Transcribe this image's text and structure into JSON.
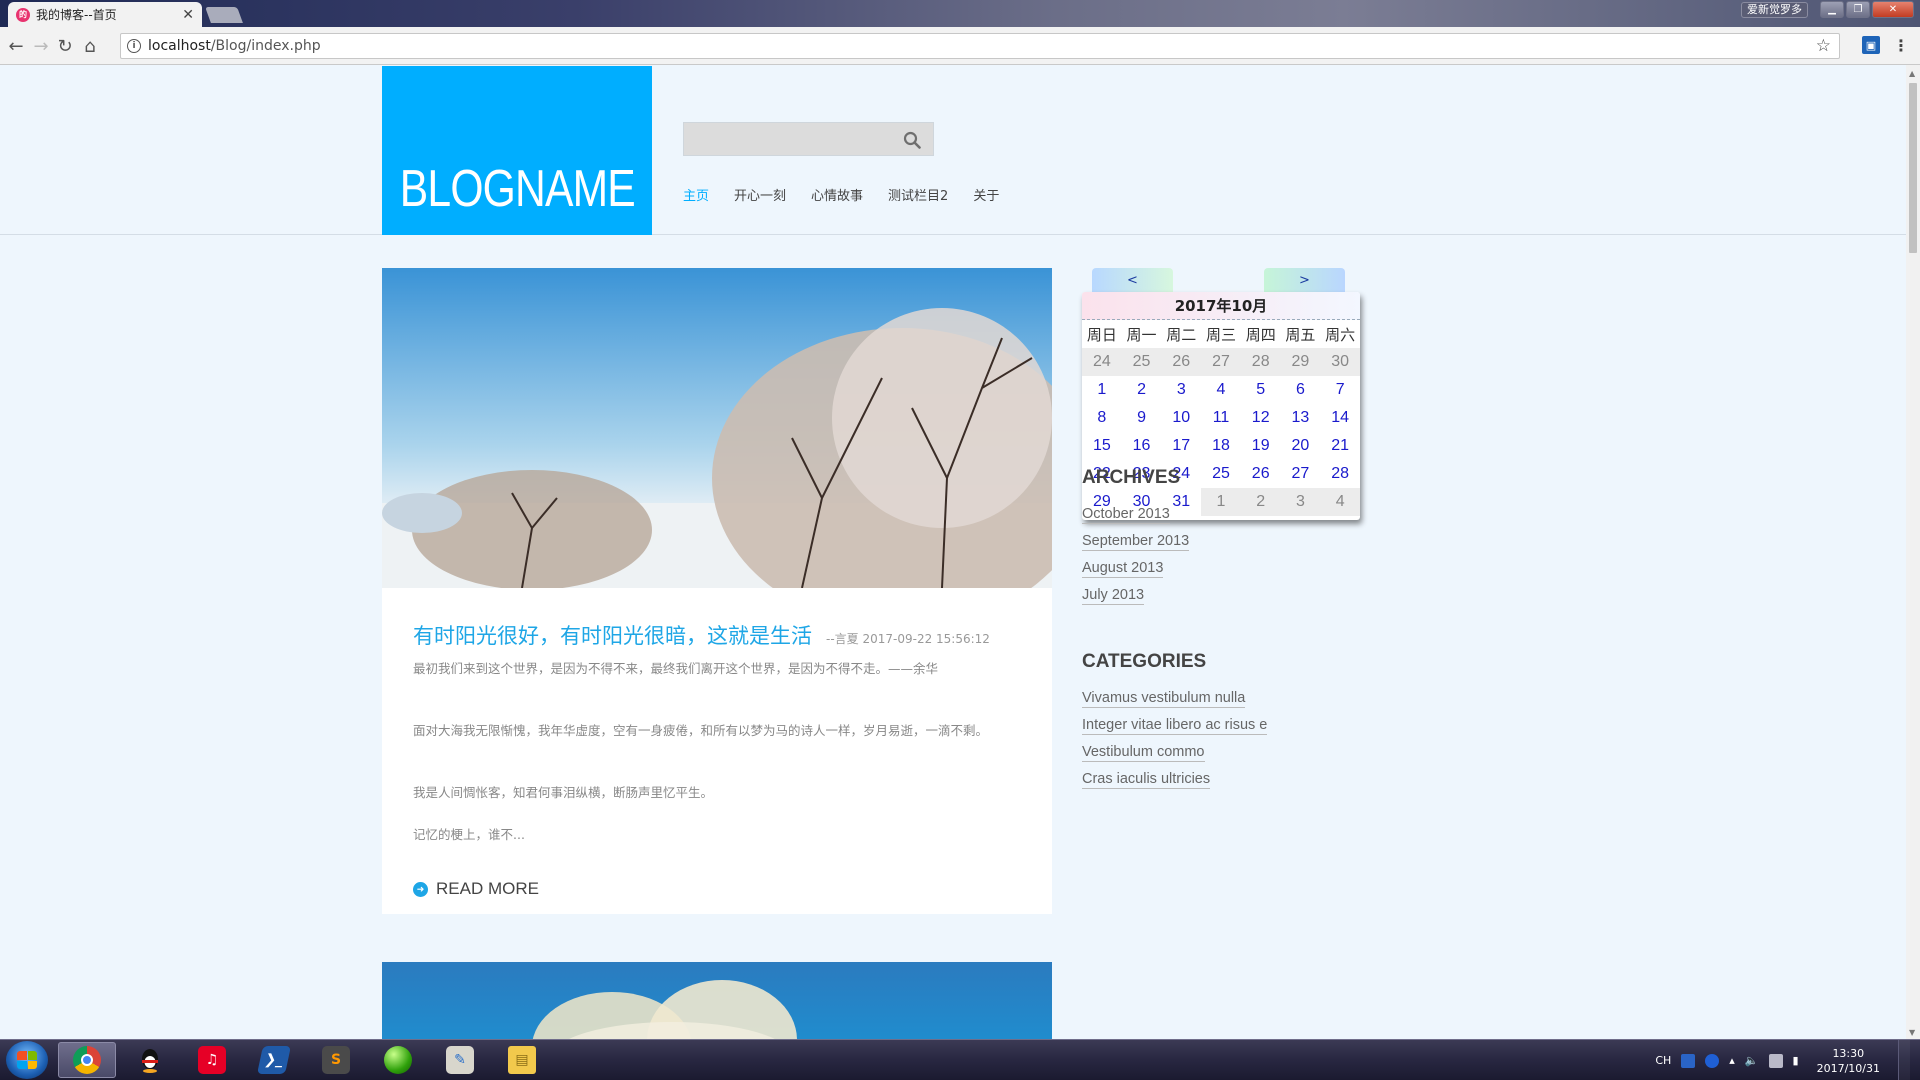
{
  "browser": {
    "tab_title": "我的博客--首页",
    "favicon_letter": "的",
    "url_host": "localhost",
    "url_path": "/Blog/index.php",
    "window_user": "爱新觉罗多"
  },
  "site": {
    "logo": "BLOGNAME",
    "search_placeholder": "",
    "nav": [
      {
        "label": "主页",
        "active": true
      },
      {
        "label": "开心一刻"
      },
      {
        "label": "心情故事"
      },
      {
        "label": "测试栏目2"
      },
      {
        "label": "关于"
      }
    ]
  },
  "post": {
    "title": "有时阳光很好，有时阳光很暗，这就是生活",
    "meta": "--言夏 2017-09-22 15:56:12",
    "paragraphs": [
      "最初我们来到这个世界，是因为不得不来，最终我们离开这个世界，是因为不得不走。——余华",
      "面对大海我无限惭愧，我年华虚度，空有一身疲倦，和所有以梦为马的诗人一样，岁月易逝，一滴不剩。",
      "我是人间惆怅客，知君何事泪纵横，断肠声里忆平生。",
      "记忆的梗上，谁不..."
    ],
    "read_more": "READ MORE"
  },
  "calendar": {
    "prev": "<",
    "next": ">",
    "title": "2017年10月",
    "weekdays": [
      "周日",
      "周一",
      "周二",
      "周三",
      "周四",
      "周五",
      "周六"
    ],
    "weeks": [
      [
        [
          "24",
          "other"
        ],
        [
          "25",
          "other"
        ],
        [
          "26",
          "other"
        ],
        [
          "27",
          "other"
        ],
        [
          "28",
          "other"
        ],
        [
          "29",
          "other"
        ],
        [
          "30",
          "other"
        ]
      ],
      [
        [
          "1",
          ""
        ],
        [
          "2",
          ""
        ],
        [
          "3",
          ""
        ],
        [
          "4",
          ""
        ],
        [
          "5",
          ""
        ],
        [
          "6",
          ""
        ],
        [
          "7",
          ""
        ]
      ],
      [
        [
          "8",
          ""
        ],
        [
          "9",
          ""
        ],
        [
          "10",
          ""
        ],
        [
          "11",
          ""
        ],
        [
          "12",
          ""
        ],
        [
          "13",
          ""
        ],
        [
          "14",
          ""
        ]
      ],
      [
        [
          "15",
          ""
        ],
        [
          "16",
          ""
        ],
        [
          "17",
          ""
        ],
        [
          "18",
          ""
        ],
        [
          "19",
          ""
        ],
        [
          "20",
          ""
        ],
        [
          "21",
          ""
        ]
      ],
      [
        [
          "22",
          ""
        ],
        [
          "23",
          ""
        ],
        [
          "24",
          ""
        ],
        [
          "25",
          ""
        ],
        [
          "26",
          ""
        ],
        [
          "27",
          ""
        ],
        [
          "28",
          ""
        ]
      ],
      [
        [
          "29",
          ""
        ],
        [
          "30",
          ""
        ],
        [
          "31",
          ""
        ],
        [
          "1",
          "other"
        ],
        [
          "2",
          "other"
        ],
        [
          "3",
          "other"
        ],
        [
          "4",
          "other"
        ]
      ]
    ]
  },
  "archives": {
    "title": "ARCHIVES",
    "items": [
      "October 2013",
      "September 2013",
      "August 2013",
      "July 2013"
    ]
  },
  "categories": {
    "title": "CATEGORIES",
    "items": [
      "Vivamus vestibulum nulla",
      "Integer vitae libero ac risus e",
      "Vestibulum commo",
      "Cras iaculis ultricies"
    ]
  },
  "taskbar": {
    "apps": [
      {
        "name": "chrome-icon",
        "active": true
      },
      {
        "name": "qq-icon"
      },
      {
        "name": "netease-music-icon"
      },
      {
        "name": "powershell-icon"
      },
      {
        "name": "sublime-text-icon"
      },
      {
        "name": "green-ball-icon"
      },
      {
        "name": "paint-icon"
      },
      {
        "name": "explorer-icon"
      }
    ],
    "lang": "CH",
    "clock_time": "13:30",
    "clock_date": "2017/10/31"
  },
  "colors": {
    "accent": "#00aeff",
    "page_bg": "#eef6fd",
    "calendar_day": "#1a1acc"
  }
}
